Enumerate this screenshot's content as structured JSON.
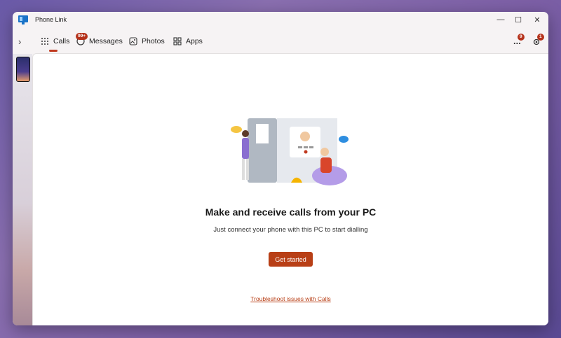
{
  "window": {
    "title": "Phone Link"
  },
  "controls": {
    "minimize": "—",
    "maximize": "☐",
    "close": "✕"
  },
  "nav": {
    "expand_icon": "chevron-right",
    "tabs": [
      {
        "label": "Calls",
        "icon": "dialpad-icon",
        "active": true
      },
      {
        "label": "Messages",
        "icon": "chat-icon",
        "badge": "99+"
      },
      {
        "label": "Photos",
        "icon": "photos-icon"
      },
      {
        "label": "Apps",
        "icon": "apps-icon"
      }
    ],
    "more_label": "...",
    "more_badge": "9",
    "settings_badge": "1"
  },
  "main": {
    "headline": "Make and receive calls from your PC",
    "subline": "Just connect your phone with this PC to start dialling",
    "cta_label": "Get started",
    "troubleshoot_link": "Troubleshoot issues with Calls"
  },
  "colors": {
    "accent": "#b83f16",
    "badge": "#b5321b"
  }
}
